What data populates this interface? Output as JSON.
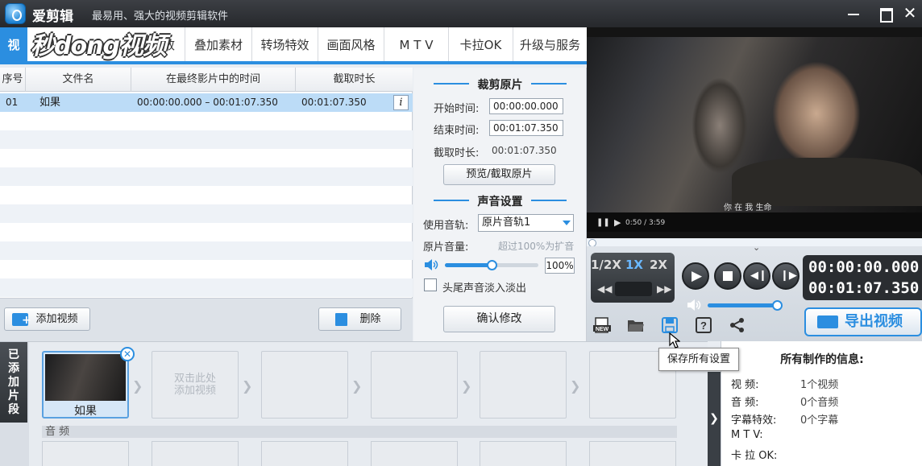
{
  "app": {
    "title": "爱剪辑",
    "subtitle": "最易用、强大的视频剪辑软件",
    "watermark": "秒dong视频"
  },
  "tabs": [
    {
      "label": "视"
    },
    {
      "label": "效"
    },
    {
      "label": "叠加素材"
    },
    {
      "label": "转场特效"
    },
    {
      "label": "画面风格"
    },
    {
      "label": "M T V"
    },
    {
      "label": "卡拉OK"
    },
    {
      "label": "升级与服务"
    }
  ],
  "table": {
    "headers": [
      "序号",
      "文件名",
      "在最终影片中的时间",
      "截取时长"
    ],
    "rows": [
      {
        "index": "01",
        "name": "如果",
        "range": "00:00:00.000 – 00:01:07.350",
        "duration": "00:01:07.350"
      }
    ],
    "info_glyph": "i"
  },
  "table_bar": {
    "add_video": "添加视频",
    "delete": "删除"
  },
  "clip_panel": {
    "trim_title": "裁剪原片",
    "start_label": "开始时间:",
    "start_value": "00:00:00.000",
    "end_label": "结束时间:",
    "end_value": "00:01:07.350",
    "duration_label": "截取时长:",
    "duration_value": "00:01:07.350",
    "preview_button": "预览/截取原片",
    "audio_title": "声音设置",
    "track_label": "使用音轨:",
    "track_value": "原片音轨1",
    "volume_label": "原片音量:",
    "volume_hint": "超过100%为扩音",
    "volume_value": "100%",
    "volume_level": 0.5,
    "fade_label": "头尾声音淡入淡出",
    "fade_checked": false,
    "confirm_button": "确认修改"
  },
  "player": {
    "subtitle_text": "你 在 我 生命",
    "small_time": "0:50 / 3:59",
    "speeds": [
      "1/2X",
      "1X",
      "2X"
    ],
    "active_speed": "1X",
    "current_time": "00:00:00.000",
    "total_time": "00:01:07.350",
    "volume_level": 0.95,
    "export_button": "导出视频",
    "tools": [
      "new-project",
      "open-folder",
      "save",
      "help",
      "share"
    ],
    "tool_new_label": "NEW"
  },
  "tooltip": "保存所有设置",
  "timeline": {
    "label": "已添加片段",
    "clip_name": "如果",
    "empty_hint": "双击此处添加视频",
    "audio_label": "音 频"
  },
  "info_panel": {
    "title": "所有制作的信息:",
    "rows": [
      {
        "label": "视    频:",
        "value": "1个视频"
      },
      {
        "label": "音    频:",
        "value": "0个音频"
      },
      {
        "label": "字幕特效:",
        "value": "0个字幕"
      },
      {
        "label": "M  T  V:",
        "value": ""
      },
      {
        "label": "卡 拉 OK:",
        "value": ""
      }
    ]
  },
  "colors": {
    "accent": "#2b8ee0",
    "titlebar": "#2f3236",
    "selected_row": "#bcdcf7"
  }
}
